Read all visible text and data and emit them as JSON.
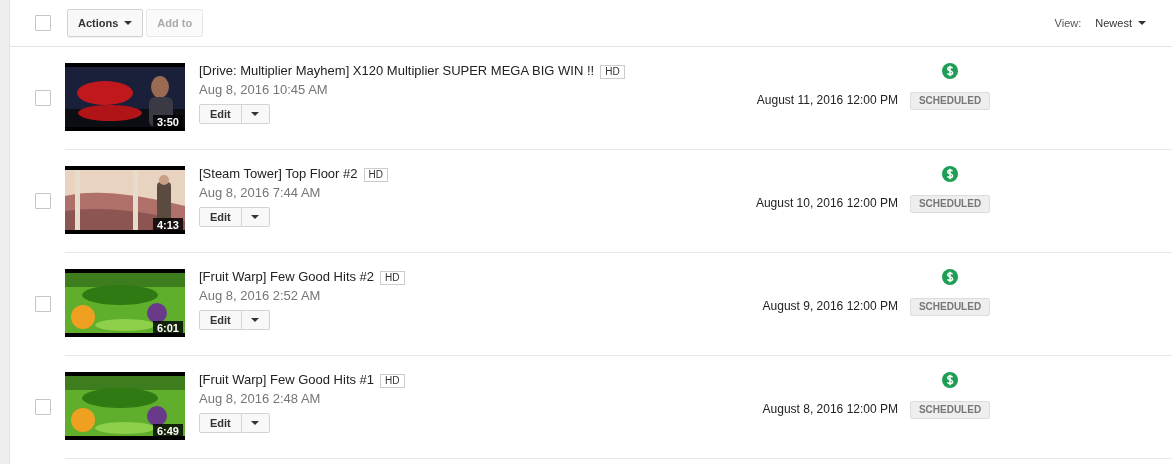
{
  "toolbar": {
    "select_all": {
      "checked": false
    },
    "actions": {
      "label": "Actions"
    },
    "add_to": {
      "label": "Add to",
      "disabled": true
    },
    "view": {
      "label": "View:",
      "value": "Newest"
    }
  },
  "videos": [
    {
      "checked": false,
      "duration": "3:50",
      "title": "[Drive: Multiplier Mayhem] X120 Multiplier SUPER MEGA BIG WIN !!",
      "hd": "HD",
      "uploaded": "Aug 8, 2016 10:45 AM",
      "edit": "Edit",
      "monetized": true,
      "scheduled_for": "August 11, 2016 12:00 PM",
      "status": "SCHEDULED"
    },
    {
      "checked": false,
      "duration": "4:13",
      "title": "[Steam Tower] Top Floor #2",
      "hd": "HD",
      "uploaded": "Aug 8, 2016 7:44 AM",
      "edit": "Edit",
      "monetized": true,
      "scheduled_for": "August 10, 2016 12:00 PM",
      "status": "SCHEDULED"
    },
    {
      "checked": false,
      "duration": "6:01",
      "title": "[Fruit Warp] Few Good Hits #2",
      "hd": "HD",
      "uploaded": "Aug 8, 2016 2:52 AM",
      "edit": "Edit",
      "monetized": true,
      "scheduled_for": "August 9, 2016 12:00 PM",
      "status": "SCHEDULED"
    },
    {
      "checked": false,
      "duration": "6:49",
      "title": "[Fruit Warp] Few Good Hits #1",
      "hd": "HD",
      "uploaded": "Aug 8, 2016 2:48 AM",
      "edit": "Edit",
      "monetized": true,
      "scheduled_for": "August 8, 2016 12:00 PM",
      "status": "SCHEDULED"
    }
  ]
}
